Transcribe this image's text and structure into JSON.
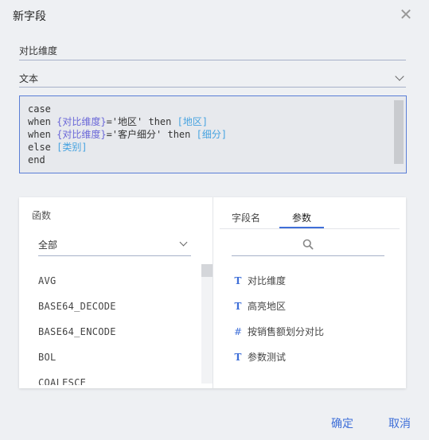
{
  "dialog": {
    "title": "新字段",
    "close_glyph": "✕"
  },
  "field_name": {
    "value": "对比维度"
  },
  "field_type": {
    "value": "文本"
  },
  "editor": {
    "lines": [
      [
        {
          "t": "case",
          "c": "kw"
        }
      ],
      [
        {
          "t": "when ",
          "c": "kw"
        },
        {
          "t": "{对比维度}",
          "c": "fld"
        },
        {
          "t": "='地区' then ",
          "c": "str"
        },
        {
          "t": "[地区]",
          "c": "prm"
        }
      ],
      [
        {
          "t": "when ",
          "c": "kw"
        },
        {
          "t": "{对比维度}",
          "c": "fld"
        },
        {
          "t": "='客户细分' then ",
          "c": "str"
        },
        {
          "t": "[细分]",
          "c": "prm"
        }
      ],
      [
        {
          "t": "else ",
          "c": "kw"
        },
        {
          "t": "[类别]",
          "c": "prm"
        }
      ],
      [
        {
          "t": "end",
          "c": "kw"
        }
      ]
    ]
  },
  "functions": {
    "title": "函数",
    "category": "全部",
    "items": [
      "AVG",
      "BASE64_DECODE",
      "BASE64_ENCODE",
      "BOL",
      "COALESCE"
    ]
  },
  "right_panel": {
    "tabs": [
      {
        "label": "字段名",
        "active": false
      },
      {
        "label": "参数",
        "active": true
      }
    ],
    "search_icon": "search-icon",
    "params": [
      {
        "icon": "T",
        "icon_name": "text-type-icon",
        "label": "对比维度"
      },
      {
        "icon": "T",
        "icon_name": "text-type-icon",
        "label": "高亮地区"
      },
      {
        "icon": "#",
        "icon_name": "number-type-icon",
        "label": "按销售额划分对比"
      },
      {
        "icon": "T",
        "icon_name": "text-type-icon",
        "label": "参数测试"
      }
    ]
  },
  "footer": {
    "confirm_label": "确定",
    "cancel_label": "取消"
  },
  "colors": {
    "accent": "#3f6fd8",
    "field_ref": "#6a67d8",
    "param_ref": "#47a3e0"
  }
}
